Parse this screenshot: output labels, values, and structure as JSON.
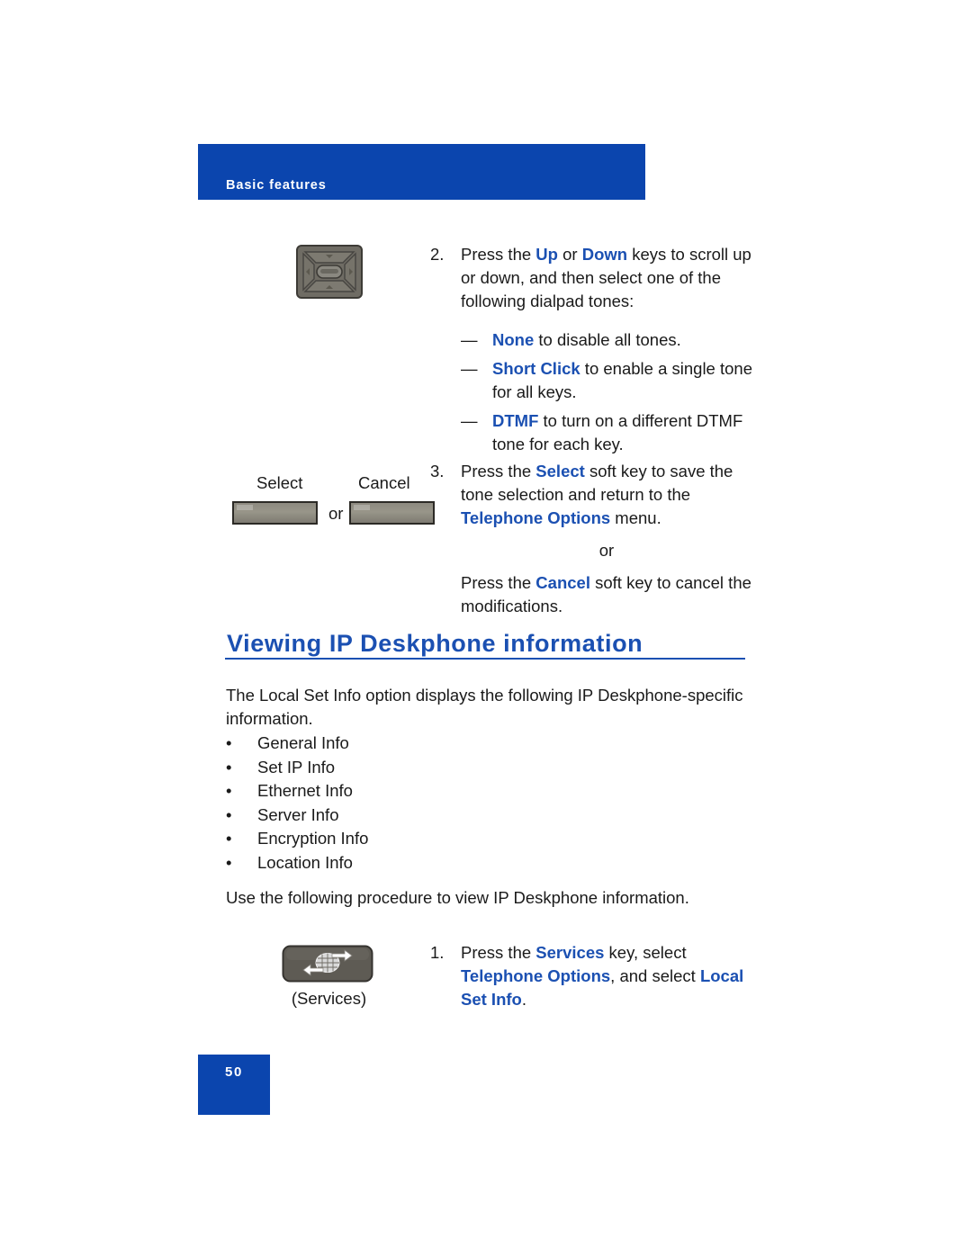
{
  "header": {
    "title": "Basic features"
  },
  "step2": {
    "number": "2.",
    "line1_pre": "Press the ",
    "line1_b1": "Up",
    "line1_mid": " or ",
    "line1_b2": "Down",
    "line1_post": " keys to scroll up or down, and then select one of the following dialpad tones:",
    "dash_mark": "—",
    "items": [
      {
        "bold": "None",
        "rest": " to disable all tones."
      },
      {
        "bold": "Short Click",
        "rest": " to enable a single tone for all keys."
      },
      {
        "bold": "DTMF",
        "rest": " to turn on a different DTMF tone for each key."
      }
    ]
  },
  "softkeys": {
    "select_label": "Select",
    "cancel_label": "Cancel",
    "or_label": "or"
  },
  "step3": {
    "number": "3.",
    "pre": "Press the ",
    "select_bold": "Select",
    "mid": " soft key to save the tone selection and return to the ",
    "options_bold": "Telephone Options",
    "post": " menu.",
    "or_label": "or",
    "cancel_pre": "Press the ",
    "cancel_bold": "Cancel",
    "cancel_post": " soft key to cancel the modifications."
  },
  "section": {
    "heading": "Viewing IP Deskphone information",
    "intro": "The Local Set Info option displays the following IP Deskphone-specific information.",
    "bullet_mark": "•",
    "bullets": [
      "General Info",
      "Set IP Info",
      "Ethernet Info",
      "Server Info",
      "Encryption Info",
      "Location Info"
    ],
    "procedure_intro": "Use the following procedure to view IP Deskphone information."
  },
  "services": {
    "caption": "(Services)"
  },
  "step1": {
    "number": "1.",
    "pre": "Press the ",
    "services_bold": "Services",
    "mid": " key, select ",
    "options_bold": "Telephone Options",
    "mid2": ", and select ",
    "local_bold": "Local Set Info",
    "post": "."
  },
  "footer": {
    "page_number": "50"
  },
  "colors": {
    "banner_blue": "#0b45ae",
    "accent_blue": "#1b50b2",
    "body_text": "#1a1a1a"
  }
}
